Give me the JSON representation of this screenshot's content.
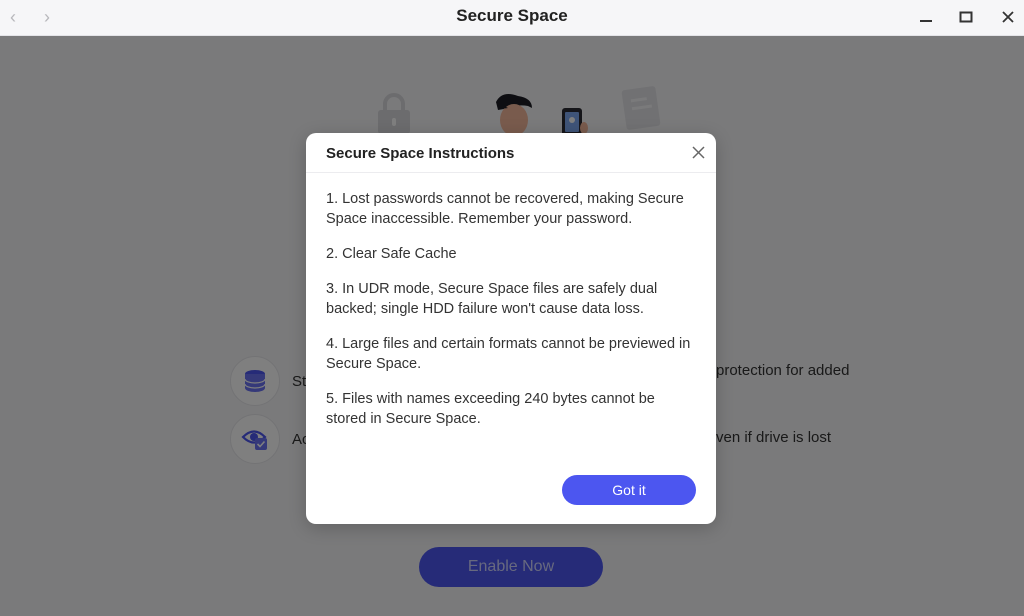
{
  "window": {
    "title": "Secure Space",
    "nav_back_glyph": "‹",
    "nav_forward_glyph": "›"
  },
  "background": {
    "features": [
      {
        "icon": "database-icon",
        "text_left": "St",
        "text_right": "protection for added"
      },
      {
        "icon": "eye-check-icon",
        "text_left": "Ac",
        "text_right": "ven if drive is lost"
      }
    ],
    "enable_button": "Enable Now"
  },
  "dialog": {
    "title": "Secure Space Instructions",
    "instructions": [
      "1. Lost passwords cannot be recovered, making Secure Space inaccessible. Remember your password.",
      "2. Clear Safe Cache",
      "3. In UDR mode, Secure Space files are safely dual backed; single HDD failure won't cause data loss.",
      "4. Large files and certain formats cannot be previewed in Secure Space.",
      "5. Files with names exceeding 240 bytes cannot be stored in Secure Space."
    ],
    "confirm_button": "Got it"
  },
  "colors": {
    "accent": "#4c56f0",
    "overlay": "rgba(0,0,0,0.5)"
  }
}
